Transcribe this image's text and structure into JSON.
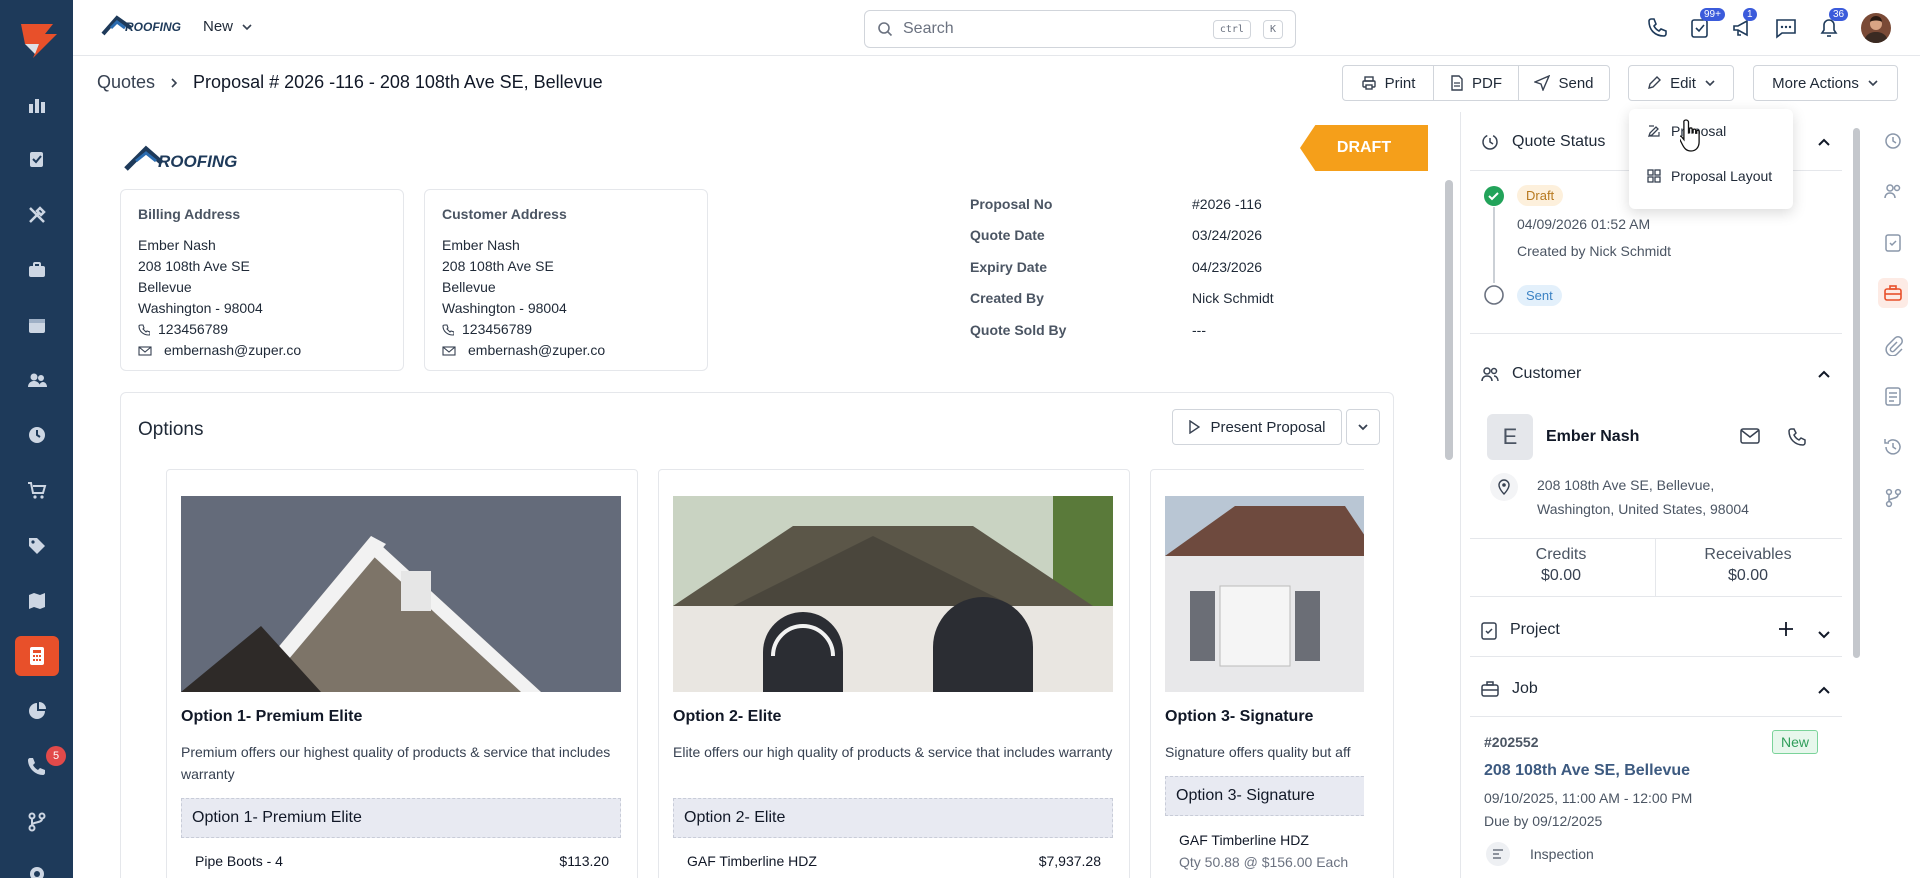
{
  "app": {
    "brand": "ROOFING"
  },
  "topbar": {
    "new_label": "New",
    "search_placeholder": "Search",
    "kbd_ctrl": "ctrl",
    "kbd_k": "K",
    "badge_tasks": "99+",
    "badge_announce": "1",
    "badge_notif": "36"
  },
  "sidebar": {
    "badge_chat": "5"
  },
  "breadcrumb": {
    "root": "Quotes",
    "current": "Proposal # 2026 -116 - 208 108th Ave SE, Bellevue"
  },
  "actions": {
    "print": "Print",
    "pdf": "PDF",
    "send": "Send",
    "edit": "Edit",
    "more": "More Actions"
  },
  "edit_menu": {
    "items": [
      "Proposal",
      "Proposal Layout"
    ]
  },
  "document": {
    "status": "DRAFT",
    "billing": {
      "title": "Billing Address",
      "name": "Ember Nash",
      "street": "208 108th Ave SE",
      "city": "Bellevue",
      "state": "Washington - 98004",
      "phone": "123456789",
      "email": "embernash@zuper.co"
    },
    "customer": {
      "title": "Customer Address",
      "name": "Ember Nash",
      "street": "208 108th Ave SE",
      "city": "Bellevue",
      "state": "Washington - 98004",
      "phone": "123456789",
      "email": "embernash@zuper.co"
    },
    "meta": [
      {
        "k": "Proposal No",
        "v": "#2026 -116"
      },
      {
        "k": "Quote Date",
        "v": "03/24/2026"
      },
      {
        "k": "Expiry Date",
        "v": "04/23/2026"
      },
      {
        "k": "Created By",
        "v": "Nick Schmidt"
      },
      {
        "k": "Quote Sold By",
        "v": "---"
      }
    ],
    "options_title": "Options",
    "present_label": "Present Proposal",
    "options": [
      {
        "name": "Option 1- Premium Elite",
        "desc": "Premium offers our highest quality of products & service that includes warranty",
        "section": "Option 1- Premium Elite",
        "item": "Pipe Boots - 4",
        "price": "$113.20"
      },
      {
        "name": "Option 2- Elite",
        "desc": "Elite offers our high quality of products & service that includes warranty",
        "section": "Option 2- Elite",
        "item": "GAF Timberline HDZ",
        "price": "$7,937.28"
      },
      {
        "name": "Option 3- Signature",
        "desc": "Signature offers quality but aff",
        "section": "Option 3- Signature",
        "item": "GAF Timberline HDZ",
        "sub": "Qty 50.88 @ $156.00 Each"
      }
    ]
  },
  "panel": {
    "quote_status": {
      "title": "Quote Status",
      "draft": "Draft",
      "draft_date": "04/09/2026 01:52 AM",
      "draft_by": "Created by Nick Schmidt",
      "sent": "Sent"
    },
    "customer": {
      "title": "Customer",
      "initial": "E",
      "name": "Ember Nash",
      "address1": "208 108th Ave SE, Bellevue,",
      "address2": "Washington, United States, 98004",
      "credits_label": "Credits",
      "credits": "$0.00",
      "receivables_label": "Receivables",
      "receivables": "$0.00"
    },
    "project": {
      "title": "Project"
    },
    "job": {
      "title": "Job",
      "number": "#202552",
      "status": "New",
      "address": "208 108th Ave SE, Bellevue",
      "time": "09/10/2025, 11:00 AM - 12:00 PM",
      "due": "Due by 09/12/2025",
      "type": "Inspection"
    }
  },
  "colors": {
    "rail": "#1e3a5a",
    "accent": "#e8502a",
    "draft": "#f59f1a"
  }
}
